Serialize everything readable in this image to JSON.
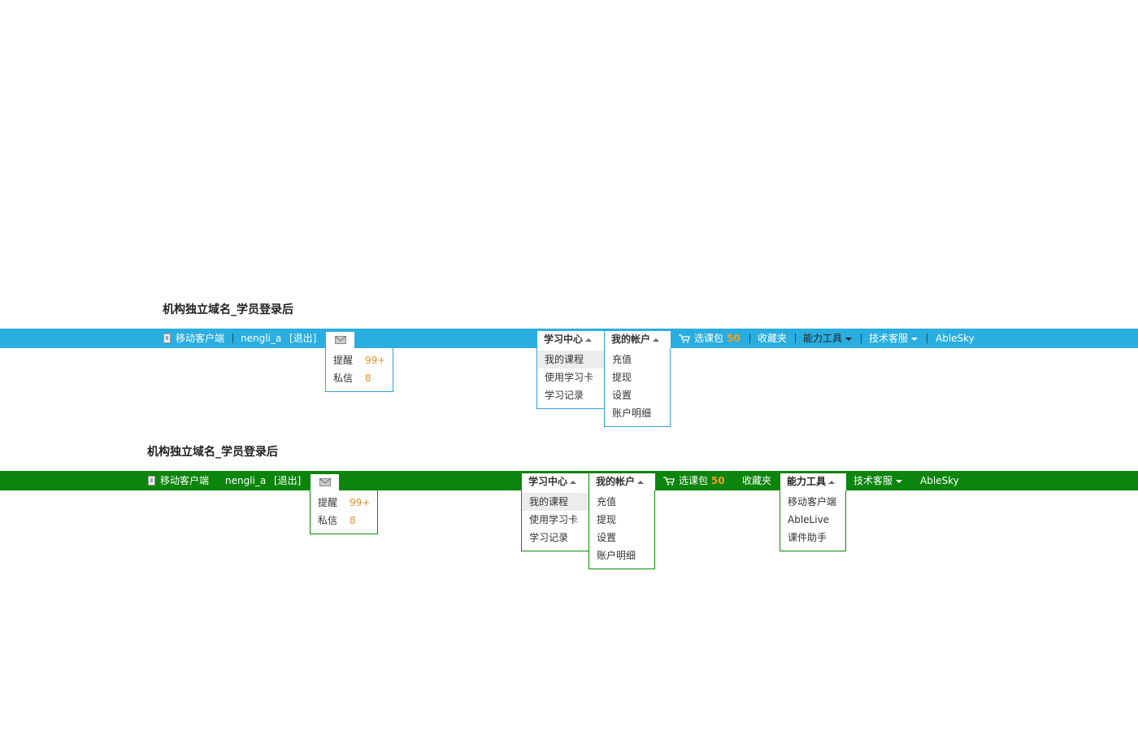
{
  "sections": [
    {
      "title": "机构独立域名_学员登录后",
      "bar_color": "#2aaee0",
      "border_color": "#33a0d8"
    },
    {
      "title": "机构独立域名_学员登录后",
      "bar_color": "#0c850c",
      "border_color": "#0c8a0c"
    }
  ],
  "topbar": {
    "mobile_client": "移动客户端",
    "username": "nengli_a",
    "logout": "[退出]",
    "mail_icon": "envelope-icon",
    "cart_label": "选课包",
    "cart_count": "50",
    "favorites": "收藏夹",
    "tools": "能力工具",
    "support": "技术客服",
    "brand": "AbleSky"
  },
  "mail_menu": {
    "reminders_label": "提醒",
    "reminders_count": "99+",
    "messages_label": "私信",
    "messages_count": "8"
  },
  "study_menu": {
    "title": "学习中心",
    "items": [
      "我的课程",
      "使用学习卡",
      "学习记录"
    ]
  },
  "account_menu": {
    "title": "我的帐户",
    "items": [
      "充值",
      "提现",
      "设置",
      "账户明细"
    ]
  },
  "tools_menu": {
    "title": "能力工具",
    "items": [
      "移动客户端",
      "AbleLive",
      "课件助手"
    ]
  }
}
